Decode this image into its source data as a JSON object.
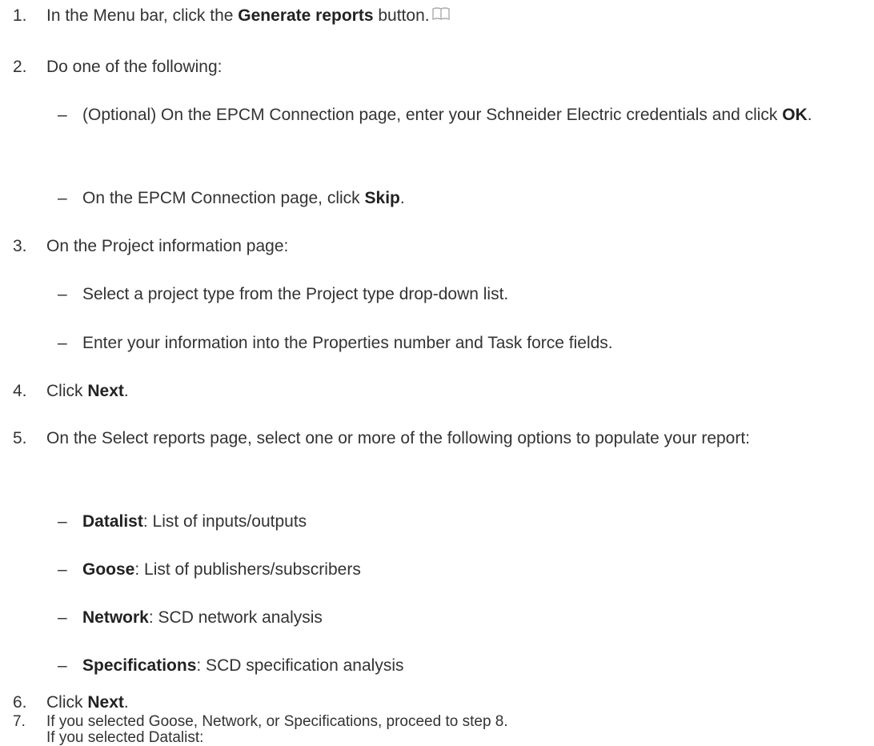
{
  "steps": [
    {
      "n": "1.",
      "before": "In the Menu bar, click the ",
      "bold": "Generate reports",
      "after": " button.",
      "icon": "book-icon"
    },
    {
      "n": "2.",
      "text": "Do one of the following:"
    },
    {
      "n": "3.",
      "text": "On the Project information page:"
    },
    {
      "n": "4.",
      "before": "Click ",
      "bold": "Next",
      "after": "."
    },
    {
      "n": "5.",
      "text": "On the Select reports page, select one or more of the following options to populate your report:"
    },
    {
      "n": "6.",
      "before": "Click ",
      "bold": "Next",
      "after": "."
    },
    {
      "n": "7.",
      "text": "If you selected Goose, Network, or Specifications, proceed to step 8.",
      "text2": "If you selected Datalist:"
    }
  ],
  "step2_subs": [
    {
      "before": "(Optional) On the EPCM Connection page, enter your Schneider Electric credentials and click ",
      "bold": "OK",
      "after": "."
    },
    {
      "before": "On the EPCM Connection page, click ",
      "bold": "Skip",
      "after": "."
    }
  ],
  "step3_subs": [
    {
      "text": "Select a project type from the Project type drop-down list."
    },
    {
      "text": "Enter your information into the Properties number and Task force fields."
    }
  ],
  "step5_subs": [
    {
      "bold": "Datalist",
      "after": ": List of inputs/outputs"
    },
    {
      "bold": "Goose",
      "after": ": List of publishers/subscribers"
    },
    {
      "bold": "Network",
      "after": ": SCD network analysis"
    },
    {
      "bold": "Specifications",
      "after": ": SCD specification analysis"
    }
  ],
  "dash": "–"
}
